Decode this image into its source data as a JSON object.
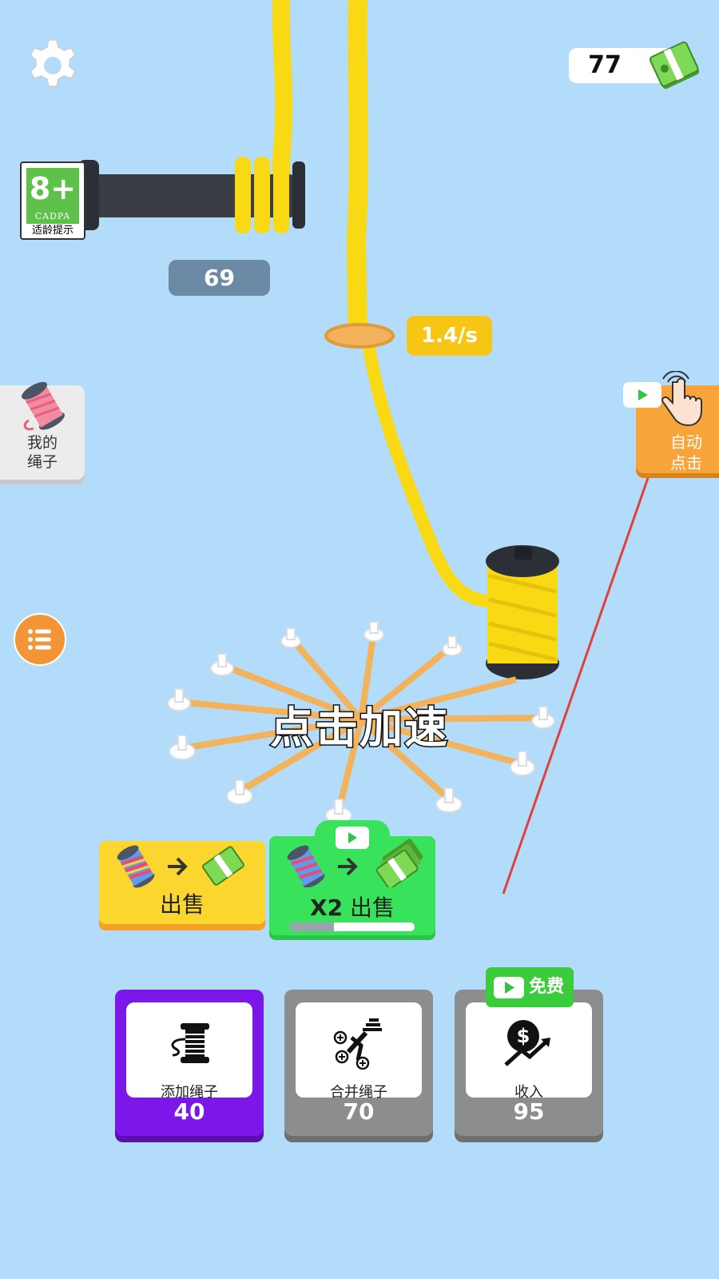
{
  "hud": {
    "money": "77",
    "age_rating": {
      "value": "8+",
      "org": "CADPA",
      "caption": "适龄提示"
    },
    "level": "69",
    "speed": "1.4/s"
  },
  "side": {
    "my_rope_label": "我的\n绳子",
    "auto_click_label": "自动\n点击"
  },
  "center": {
    "tap_hint": "点击加速"
  },
  "sell": {
    "label": "出售",
    "x2_multiplier": "X2",
    "x2_label": "出售",
    "ad_progress": 0.35
  },
  "upgrades": [
    {
      "title": "添加绳子",
      "cost": "40"
    },
    {
      "title": "合并绳子",
      "cost": "70"
    },
    {
      "title": "收入",
      "cost": "95",
      "badge": "免费"
    }
  ],
  "colors": {
    "background": "#b3dcfa",
    "rope": "#f8d913",
    "add_card": "#7b18e9",
    "locked_card": "#8d8d8d",
    "sell": "#fbd62e",
    "sell_x2": "#38e35b"
  },
  "icons": [
    "gear-icon",
    "cash-icon",
    "spool-icon",
    "hand-tap-icon",
    "video-icon",
    "list-icon",
    "rope-spool-icon",
    "merge-icon",
    "income-icon",
    "arrow-icon"
  ]
}
